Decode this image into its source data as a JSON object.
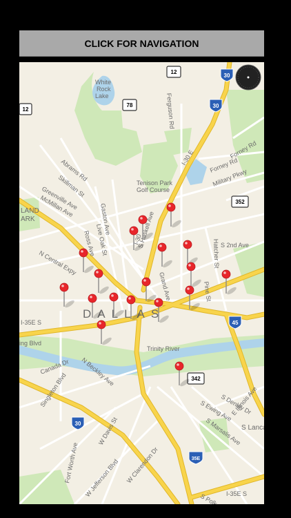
{
  "nav": {
    "label": "CLICK FOR NAVIGATION"
  },
  "map": {
    "city_label": "DALLAS",
    "lake_label_line1": "White",
    "lake_label_line2": "Rock",
    "lake_label_line3": "Lake",
    "park_label_line1": "Tenison Park",
    "park_label_line2": "Golf Course",
    "district_label_line1": "LAND",
    "district_label_line2": "ARK",
    "streets": [
      "Abrams Rd",
      "Skillman St",
      "Greenville Ave",
      "McMillan Ave",
      "Gaston Ave",
      "Live Oak St",
      "Ross Ave",
      "N Central Expy",
      "Ferguson Rd",
      "S Haskell Ave",
      "Grand Ave",
      "Hatcher St",
      "S 2nd Ave",
      "Pine St",
      "Forney Rd",
      "Forney Rd",
      "Military Pkwy",
      "Canada Dr",
      "N Beckley Ave",
      "Singleton Blvd",
      "Fort Worth Ave",
      "W Davis St",
      "W Jefferson Blvd",
      "W Clarendon Dr",
      "S Denley Dr",
      "S Ewing Ave",
      "S Marsalis Ave",
      "E Illinois Ave",
      "S Lanca",
      "I-35E S",
      "I-35E S",
      "I-30 E",
      "I-30",
      "Trinity River",
      "ing Blvd",
      "S Polk"
    ],
    "shields": [
      {
        "number": "12",
        "kind": "state"
      },
      {
        "number": "12",
        "kind": "state"
      },
      {
        "number": "78",
        "kind": "state"
      },
      {
        "number": "352",
        "kind": "state"
      },
      {
        "number": "342",
        "kind": "state"
      },
      {
        "number": "30",
        "kind": "interstate"
      },
      {
        "number": "30",
        "kind": "interstate"
      },
      {
        "number": "30",
        "kind": "interstate"
      },
      {
        "number": "45",
        "kind": "interstate"
      },
      {
        "number": "35E",
        "kind": "interstate"
      }
    ],
    "pin_count": 20,
    "colors": {
      "land": "#f3efe4",
      "park": "#cfe8b8",
      "water": "#aed3ea",
      "highway": "#f8d44c",
      "highway_edge": "#e0b628",
      "road": "#ffffff",
      "pin": "#e8262b"
    }
  },
  "compass": {
    "icon": "compass-icon"
  }
}
